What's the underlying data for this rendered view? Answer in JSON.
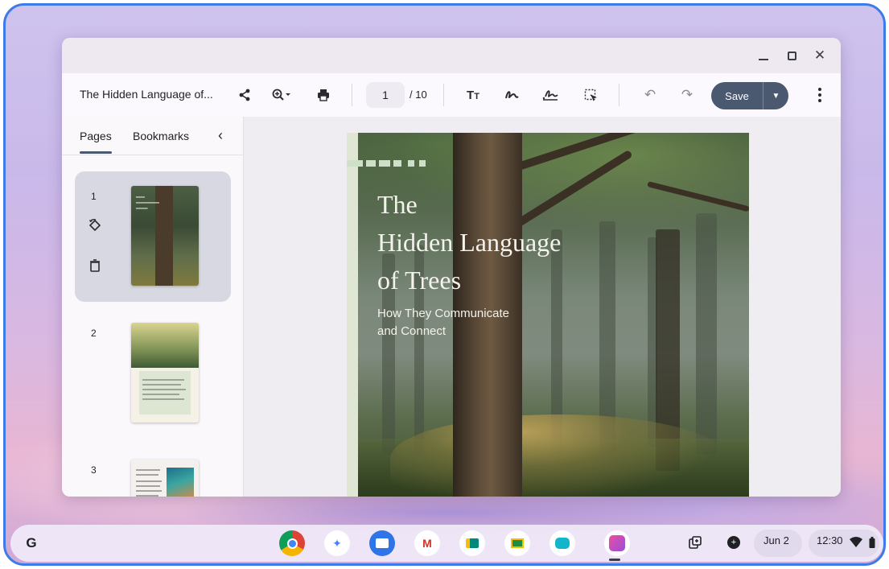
{
  "window": {
    "doc_title": "The Hidden Language of...",
    "page_current": "1",
    "page_total": "/ 10",
    "save_label": "Save"
  },
  "sidebar": {
    "tabs": [
      {
        "label": "Pages"
      },
      {
        "label": "Bookmarks"
      }
    ],
    "thumbnails": [
      {
        "number": "1"
      },
      {
        "number": "2"
      },
      {
        "number": "3"
      }
    ]
  },
  "cover": {
    "title": "The\nHidden Language\nof Trees",
    "subtitle": "How They Communicate\nand Connect"
  },
  "shelf": {
    "date": "Jun 2",
    "time": "12:30",
    "apps": [
      "chrome-icon",
      "gemini-icon",
      "files-icon",
      "gmail-icon",
      "meet-icon",
      "classroom-icon",
      "chat-icon",
      "pdf-editor-icon"
    ]
  },
  "colors": {
    "accent": "#4a5870",
    "frame": "#3d7be8"
  }
}
